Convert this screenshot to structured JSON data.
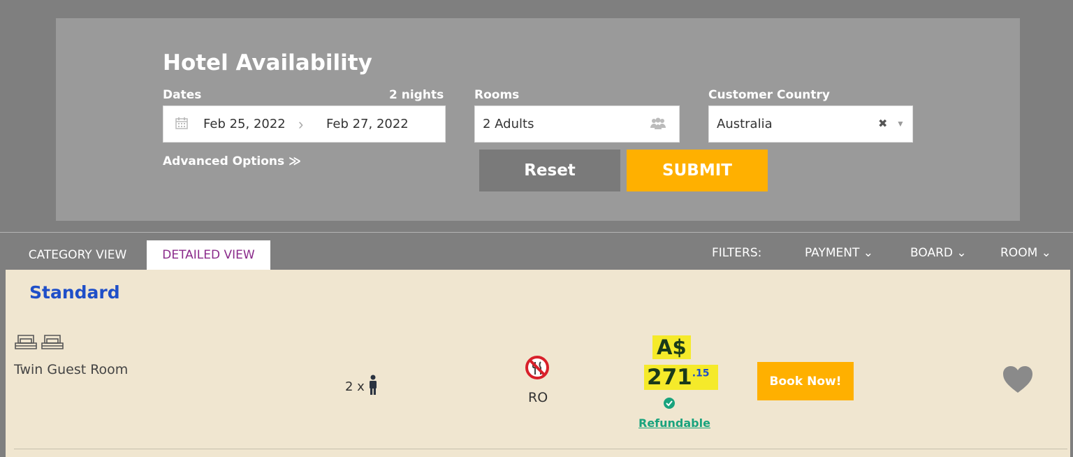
{
  "search": {
    "title": "Hotel Availability",
    "dates_label": "Dates",
    "nights": "2 nights",
    "checkin": "Feb 25, 2022",
    "checkout": "Feb 27, 2022",
    "rooms_label": "Rooms",
    "rooms_value": "2 Adults",
    "country_label": "Customer Country",
    "country_value": "Australia",
    "advanced_label": "Advanced Options ≫",
    "reset_label": "Reset",
    "submit_label": "SUBMIT"
  },
  "tabs": {
    "category": "CATEGORY VIEW",
    "detailed": "DETAILED VIEW"
  },
  "filters": {
    "label": "FILTERS:",
    "payment": "PAYMENT ⌄",
    "board": "BOARD ⌄",
    "room": "ROOM ⌄"
  },
  "result": {
    "category": "Standard",
    "room_name": "Twin Guest Room",
    "occupancy": "2 x",
    "board_code": "RO",
    "currency": "A$",
    "price_main": "271",
    "price_cents": ".15",
    "refundable": "Refundable",
    "book_label": "Book Now!"
  },
  "colors": {
    "accent": "#ffb000",
    "category_title": "#1f4fc8",
    "refund": "#19a37d",
    "highlight": "#f5ea2a",
    "active_tab": "#8a2a8a"
  }
}
